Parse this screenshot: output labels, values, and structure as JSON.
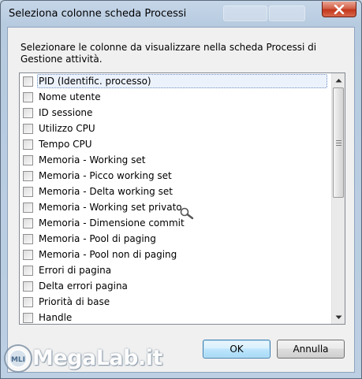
{
  "window": {
    "title": "Seleziona colonne scheda Processi",
    "close_icon": "close-icon"
  },
  "instructions": "Selezionare le colonne da visualizzare nella scheda Processi di Gestione attività.",
  "columns": [
    {
      "label": "PID (Identific. processo)",
      "checked": false,
      "focused": true
    },
    {
      "label": "Nome utente",
      "checked": false
    },
    {
      "label": "ID sessione",
      "checked": false
    },
    {
      "label": "Utilizzo CPU",
      "checked": false
    },
    {
      "label": "Tempo CPU",
      "checked": false
    },
    {
      "label": "Memoria - Working set",
      "checked": false
    },
    {
      "label": "Memoria - Picco working set",
      "checked": false
    },
    {
      "label": "Memoria - Delta working set",
      "checked": false
    },
    {
      "label": "Memoria - Working set privato",
      "checked": false
    },
    {
      "label": "Memoria - Dimensione commit",
      "checked": false
    },
    {
      "label": "Memoria - Pool di paging",
      "checked": false
    },
    {
      "label": "Memoria - Pool non di paging",
      "checked": false
    },
    {
      "label": "Errori di pagina",
      "checked": false
    },
    {
      "label": "Delta errori pagina",
      "checked": false
    },
    {
      "label": "Priorità di base",
      "checked": false
    },
    {
      "label": "Handle",
      "checked": false
    }
  ],
  "buttons": {
    "ok_label": "OK",
    "cancel_label": "Annulla"
  },
  "watermark": {
    "text": "MegaLab.it",
    "logo_text": "MLI"
  },
  "colors": {
    "titlebar": "#b9cde2",
    "close_button": "#c8432a",
    "selection_border": "#6b8dbf",
    "default_button_border": "#3c7fb1"
  }
}
